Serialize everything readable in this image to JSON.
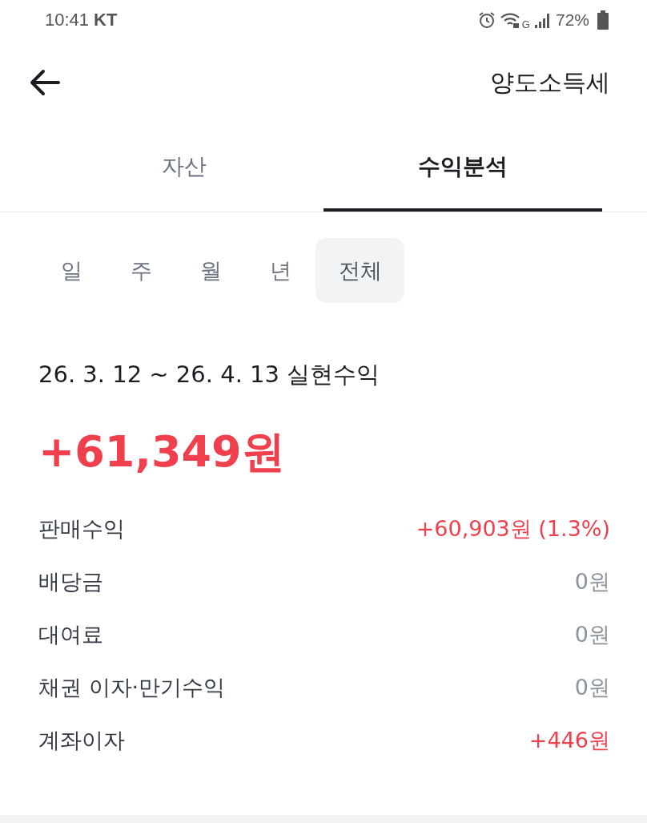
{
  "status_bar": {
    "time": "10:41",
    "carrier": "KT",
    "network": "G",
    "battery": "72%"
  },
  "header": {
    "title": "양도소득세"
  },
  "tabs": [
    {
      "label": "자산",
      "selected": false
    },
    {
      "label": "수익분석",
      "selected": true
    }
  ],
  "periods": [
    {
      "label": "일",
      "selected": false
    },
    {
      "label": "주",
      "selected": false
    },
    {
      "label": "월",
      "selected": false
    },
    {
      "label": "년",
      "selected": false
    },
    {
      "label": "전체",
      "selected": true
    }
  ],
  "summary": {
    "period": "26. 3. 12 ~ 26. 4. 13 실현수익",
    "amount": "+61,349원"
  },
  "rows": [
    {
      "label": "판매수익",
      "value": "+60,903원 (1.3%)",
      "kind": "gain"
    },
    {
      "label": "배당금",
      "value": "0원",
      "kind": "zero"
    },
    {
      "label": "대여료",
      "value": "0원",
      "kind": "zero"
    },
    {
      "label": "채권 이자·만기수익",
      "value": "0원",
      "kind": "zero"
    },
    {
      "label": "계좌이자",
      "value": "+446원",
      "kind": "gain"
    }
  ]
}
